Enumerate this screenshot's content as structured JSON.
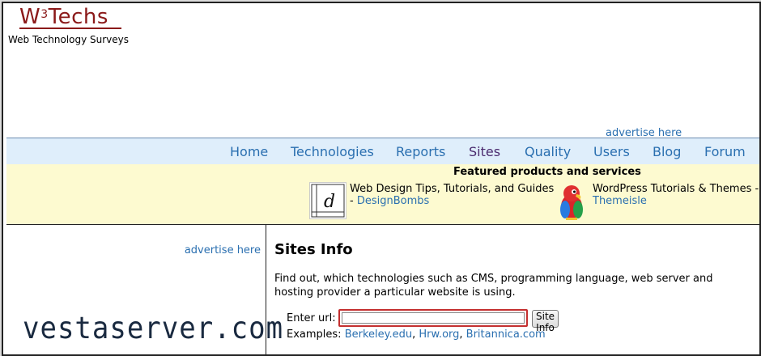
{
  "logo": {
    "main": "W",
    "sup": "3",
    "rest": "Techs",
    "tagline": "Web Technology Surveys"
  },
  "ads": {
    "top": "advertise here",
    "left": "advertise here"
  },
  "nav": {
    "items": [
      {
        "label": "Home"
      },
      {
        "label": "Technologies"
      },
      {
        "label": "Reports"
      },
      {
        "label": "Sites"
      },
      {
        "label": "Quality"
      },
      {
        "label": "Users"
      },
      {
        "label": "Blog"
      },
      {
        "label": "Forum"
      }
    ],
    "active": "Sites"
  },
  "featured": {
    "title": "Featured products and services",
    "promos": [
      {
        "text": "Web Design Tips, Tutorials, and Guides",
        "prefix": "- ",
        "link": "DesignBombs",
        "icon": "designbombs-logo-icon"
      },
      {
        "text": "WordPress Tutorials & Themes -",
        "link": "Themeisle",
        "icon": "parrot-icon"
      }
    ]
  },
  "watermark": "vestaserver.com",
  "main": {
    "title": "Sites Info",
    "description": "Find out, which technologies such as CMS, programming language, web server and hosting provider a particular website is using.",
    "url_label": "Enter url:",
    "url_value": "",
    "button": "Site Info",
    "examples_label": "Examples:",
    "examples": [
      "Berkeley.edu",
      "Hrw.org",
      "Britannica.com"
    ]
  },
  "colors": {
    "link": "#2a6fb0",
    "logo": "#8b1a1a",
    "nav_bg": "#dfeefb",
    "featured_bg": "#fdfad0",
    "highlight": "#c43030"
  }
}
